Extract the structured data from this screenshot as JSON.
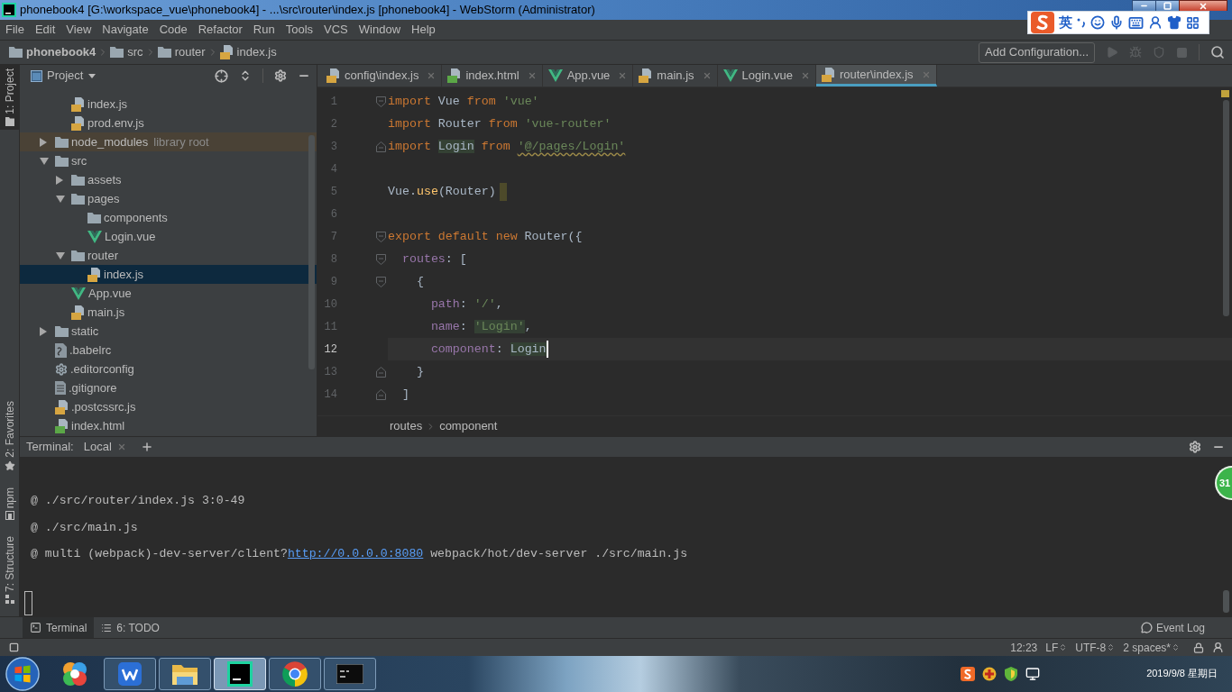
{
  "window": {
    "title": "phonebook4 [G:\\workspace_vue\\phonebook4] - ...\\src\\router\\index.js [phonebook4] - WebStorm (Administrator)"
  },
  "ime_bar": {
    "mode": "英"
  },
  "menu": [
    "File",
    "Edit",
    "View",
    "Navigate",
    "Code",
    "Refactor",
    "Run",
    "Tools",
    "VCS",
    "Window",
    "Help"
  ],
  "navigation": {
    "crumbs": [
      {
        "label": "phonebook4",
        "kind": "folder"
      },
      {
        "label": "src",
        "kind": "folder"
      },
      {
        "label": "router",
        "kind": "folder"
      },
      {
        "label": "index.js",
        "kind": "js"
      }
    ],
    "run_configuration": "Add Configuration..."
  },
  "tool_windows": {
    "top": [
      {
        "label": "1: Project",
        "kind": "project",
        "selected": true
      }
    ],
    "bottom": [
      {
        "label": "2: Favorites",
        "kind": "favorites",
        "selected": false
      },
      {
        "label": "npm",
        "kind": "npm",
        "selected": false
      },
      {
        "label": "7: Structure",
        "kind": "structure",
        "selected": false
      }
    ]
  },
  "project": {
    "title": "Project",
    "tree": {
      "children": [
        {
          "children": [
            {
              "label": "index.js",
              "kind": "js",
              "selected": false
            },
            {
              "label": "prod.env.js",
              "kind": "js",
              "selected": false
            }
          ]
        },
        {
          "label": "node_modules",
          "kind": "library",
          "note": "library root",
          "expanded": false,
          "selected": false
        },
        {
          "label": "src",
          "kind": "folder",
          "expanded": true,
          "selected": false,
          "children": [
            {
              "label": "assets",
              "kind": "folder",
              "expanded": false,
              "selected": false
            },
            {
              "label": "pages",
              "kind": "folder",
              "expanded": true,
              "selected": false,
              "children": [
                {
                  "label": "components",
                  "kind": "folder",
                  "selected": false
                },
                {
                  "label": "Login.vue",
                  "kind": "vue",
                  "selected": false
                }
              ]
            },
            {
              "label": "router",
              "kind": "folder",
              "expanded": true,
              "selected": false,
              "children": [
                {
                  "label": "index.js",
                  "kind": "js",
                  "selected": true
                }
              ]
            },
            {
              "label": "App.vue",
              "kind": "vue",
              "selected": false
            },
            {
              "label": "main.js",
              "kind": "js",
              "selected": false
            }
          ]
        },
        {
          "label": "static",
          "kind": "folder",
          "expanded": false,
          "selected": false
        },
        {
          "label": ".babelrc",
          "kind": "babel",
          "selected": false
        },
        {
          "label": ".editorconfig",
          "kind": "config",
          "selected": false
        },
        {
          "label": ".gitignore",
          "kind": "text",
          "selected": false
        },
        {
          "label": ".postcssrc.js",
          "kind": "js",
          "selected": false
        },
        {
          "label": "index.html",
          "kind": "html",
          "selected": false
        }
      ]
    }
  },
  "editor": {
    "tabs": [
      {
        "label": "config\\index.js",
        "kind": "js",
        "selected": false
      },
      {
        "label": "index.html",
        "kind": "html",
        "selected": false
      },
      {
        "label": "App.vue",
        "kind": "vue",
        "selected": false
      },
      {
        "label": "main.js",
        "kind": "js",
        "selected": false
      },
      {
        "label": "Login.vue",
        "kind": "vue",
        "selected": false
      },
      {
        "label": "router\\index.js",
        "kind": "js",
        "selected": true
      }
    ],
    "lines": [
      {
        "number": "1",
        "kind": "opener",
        "current": false,
        "tokens": [
          {
            "text": "import",
            "kind": "keyword"
          },
          {
            "text": " Vue ",
            "kind": "plain"
          },
          {
            "text": "from ",
            "kind": "keyword"
          },
          {
            "text": "'vue'",
            "kind": "string"
          }
        ]
      },
      {
        "number": "2",
        "kind": "plain",
        "current": false,
        "tokens": [
          {
            "text": "import",
            "kind": "keyword"
          },
          {
            "text": " Router ",
            "kind": "plain"
          },
          {
            "text": "from ",
            "kind": "keyword"
          },
          {
            "text": "'vue-router'",
            "kind": "string"
          }
        ]
      },
      {
        "number": "3",
        "kind": "closer",
        "current": false,
        "tokens": [
          {
            "text": "import ",
            "kind": "keyword"
          },
          {
            "text": "Login",
            "kind": "usage"
          },
          {
            "text": " from ",
            "kind": "keyword"
          },
          {
            "text": "'@/pages/Login'",
            "kind": "unresolved"
          }
        ]
      },
      {
        "number": "4",
        "kind": "plain",
        "current": false
      },
      {
        "number": "5",
        "kind": "marked",
        "current": false,
        "tokens": [
          {
            "text": "Vue.",
            "kind": "plain"
          },
          {
            "text": "use",
            "kind": "function"
          },
          {
            "text": "(Router)",
            "kind": "plain"
          }
        ]
      },
      {
        "number": "6",
        "kind": "plain",
        "current": false
      },
      {
        "number": "7",
        "kind": "opener",
        "current": false,
        "tokens": [
          {
            "text": "export default new",
            "kind": "keyword"
          },
          {
            "text": " Router({",
            "kind": "plain"
          }
        ]
      },
      {
        "number": "8",
        "kind": "opener",
        "current": false,
        "tokens": [
          {
            "text": "  routes",
            "kind": "property"
          },
          {
            "text": ": [",
            "kind": "plain"
          }
        ]
      },
      {
        "number": "9",
        "kind": "opener",
        "current": false,
        "tokens": [
          {
            "text": "    {",
            "kind": "plain"
          }
        ]
      },
      {
        "number": "10",
        "kind": "plain",
        "current": false,
        "tokens": [
          {
            "text": "      path",
            "kind": "property"
          },
          {
            "text": ": ",
            "kind": "plain"
          },
          {
            "text": "'/'",
            "kind": "string"
          },
          {
            "text": ",",
            "kind": "plain"
          }
        ]
      },
      {
        "number": "11",
        "kind": "plain",
        "current": false,
        "tokens": [
          {
            "text": "      name",
            "kind": "property"
          },
          {
            "text": ": ",
            "kind": "plain"
          },
          {
            "text": "'Login'",
            "kind": "occurrence"
          },
          {
            "text": ",",
            "kind": "plain"
          }
        ]
      },
      {
        "number": "12",
        "kind": "plain",
        "current": true,
        "tokens": [
          {
            "text": "      component",
            "kind": "property"
          },
          {
            "text": ": ",
            "kind": "plain"
          },
          {
            "text": "Login",
            "kind": "usage"
          }
        ]
      },
      {
        "number": "13",
        "kind": "closer",
        "current": false,
        "tokens": [
          {
            "text": "    }",
            "kind": "plain"
          }
        ]
      },
      {
        "number": "14",
        "kind": "closer",
        "current": false,
        "tokens": [
          {
            "text": "  ]",
            "kind": "plain"
          }
        ]
      }
    ],
    "breadcrumb": [
      "routes",
      "component"
    ]
  },
  "terminal": {
    "title": "Terminal:",
    "sessions": [
      "Local"
    ],
    "lines": [
      {
        "text": "@ ./src/router/index.js 3:0-49"
      },
      {
        "text": "@ ./src/main.js"
      },
      {
        "text": "@ multi (webpack)-dev-server/client?",
        "link": "http://0.0.0.0:8080",
        "rest": " webpack/hot/dev-server ./src/main.js"
      }
    ]
  },
  "floating_widget": {
    "text": "31"
  },
  "tool_tabs": [
    {
      "label": "Terminal",
      "kind": "terminal",
      "selected": true
    },
    {
      "label": "6: TODO",
      "kind": "todo",
      "selected": false
    }
  ],
  "event_log": "Event Log",
  "status_bar": {
    "position": "12:23",
    "line_separator": "LF",
    "encoding": "UTF-8",
    "indent": "2 spaces*"
  },
  "taskbar": {
    "apps": [
      {
        "kind": "security",
        "open": false,
        "selected": false
      },
      {
        "kind": "office",
        "open": true,
        "selected": false
      },
      {
        "kind": "files",
        "open": true,
        "selected": false
      },
      {
        "kind": "ide",
        "open": true,
        "selected": true
      },
      {
        "kind": "browser",
        "open": true,
        "selected": false
      },
      {
        "kind": "console",
        "open": true,
        "selected": false
      }
    ],
    "date": "2019/9/8 星期日"
  }
}
